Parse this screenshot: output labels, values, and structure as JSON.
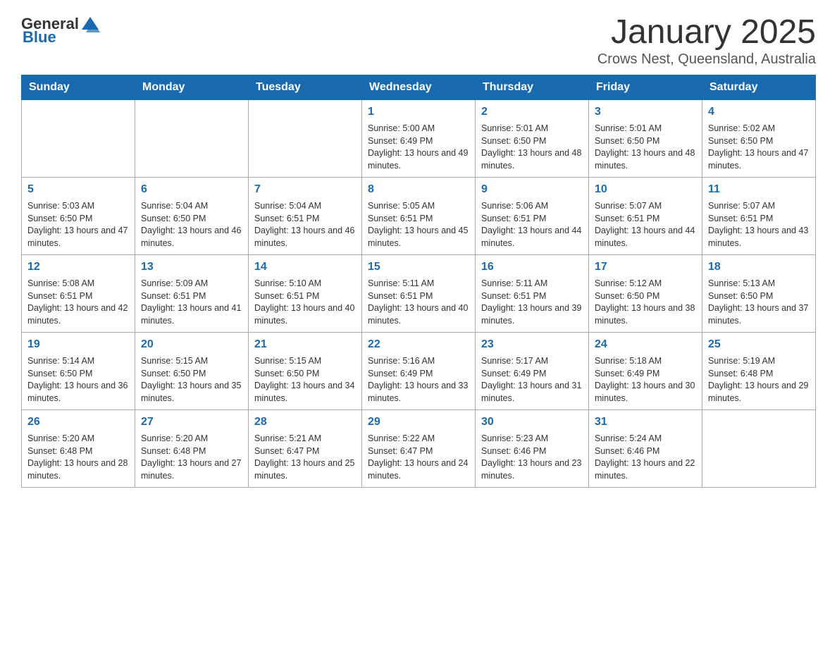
{
  "logo": {
    "text_general": "General",
    "text_blue": "Blue"
  },
  "title": "January 2025",
  "subtitle": "Crows Nest, Queensland, Australia",
  "days_of_week": [
    "Sunday",
    "Monday",
    "Tuesday",
    "Wednesday",
    "Thursday",
    "Friday",
    "Saturday"
  ],
  "weeks": [
    [
      {
        "day": "",
        "info": ""
      },
      {
        "day": "",
        "info": ""
      },
      {
        "day": "",
        "info": ""
      },
      {
        "day": "1",
        "info": "Sunrise: 5:00 AM\nSunset: 6:49 PM\nDaylight: 13 hours and 49 minutes."
      },
      {
        "day": "2",
        "info": "Sunrise: 5:01 AM\nSunset: 6:50 PM\nDaylight: 13 hours and 48 minutes."
      },
      {
        "day": "3",
        "info": "Sunrise: 5:01 AM\nSunset: 6:50 PM\nDaylight: 13 hours and 48 minutes."
      },
      {
        "day": "4",
        "info": "Sunrise: 5:02 AM\nSunset: 6:50 PM\nDaylight: 13 hours and 47 minutes."
      }
    ],
    [
      {
        "day": "5",
        "info": "Sunrise: 5:03 AM\nSunset: 6:50 PM\nDaylight: 13 hours and 47 minutes."
      },
      {
        "day": "6",
        "info": "Sunrise: 5:04 AM\nSunset: 6:50 PM\nDaylight: 13 hours and 46 minutes."
      },
      {
        "day": "7",
        "info": "Sunrise: 5:04 AM\nSunset: 6:51 PM\nDaylight: 13 hours and 46 minutes."
      },
      {
        "day": "8",
        "info": "Sunrise: 5:05 AM\nSunset: 6:51 PM\nDaylight: 13 hours and 45 minutes."
      },
      {
        "day": "9",
        "info": "Sunrise: 5:06 AM\nSunset: 6:51 PM\nDaylight: 13 hours and 44 minutes."
      },
      {
        "day": "10",
        "info": "Sunrise: 5:07 AM\nSunset: 6:51 PM\nDaylight: 13 hours and 44 minutes."
      },
      {
        "day": "11",
        "info": "Sunrise: 5:07 AM\nSunset: 6:51 PM\nDaylight: 13 hours and 43 minutes."
      }
    ],
    [
      {
        "day": "12",
        "info": "Sunrise: 5:08 AM\nSunset: 6:51 PM\nDaylight: 13 hours and 42 minutes."
      },
      {
        "day": "13",
        "info": "Sunrise: 5:09 AM\nSunset: 6:51 PM\nDaylight: 13 hours and 41 minutes."
      },
      {
        "day": "14",
        "info": "Sunrise: 5:10 AM\nSunset: 6:51 PM\nDaylight: 13 hours and 40 minutes."
      },
      {
        "day": "15",
        "info": "Sunrise: 5:11 AM\nSunset: 6:51 PM\nDaylight: 13 hours and 40 minutes."
      },
      {
        "day": "16",
        "info": "Sunrise: 5:11 AM\nSunset: 6:51 PM\nDaylight: 13 hours and 39 minutes."
      },
      {
        "day": "17",
        "info": "Sunrise: 5:12 AM\nSunset: 6:50 PM\nDaylight: 13 hours and 38 minutes."
      },
      {
        "day": "18",
        "info": "Sunrise: 5:13 AM\nSunset: 6:50 PM\nDaylight: 13 hours and 37 minutes."
      }
    ],
    [
      {
        "day": "19",
        "info": "Sunrise: 5:14 AM\nSunset: 6:50 PM\nDaylight: 13 hours and 36 minutes."
      },
      {
        "day": "20",
        "info": "Sunrise: 5:15 AM\nSunset: 6:50 PM\nDaylight: 13 hours and 35 minutes."
      },
      {
        "day": "21",
        "info": "Sunrise: 5:15 AM\nSunset: 6:50 PM\nDaylight: 13 hours and 34 minutes."
      },
      {
        "day": "22",
        "info": "Sunrise: 5:16 AM\nSunset: 6:49 PM\nDaylight: 13 hours and 33 minutes."
      },
      {
        "day": "23",
        "info": "Sunrise: 5:17 AM\nSunset: 6:49 PM\nDaylight: 13 hours and 31 minutes."
      },
      {
        "day": "24",
        "info": "Sunrise: 5:18 AM\nSunset: 6:49 PM\nDaylight: 13 hours and 30 minutes."
      },
      {
        "day": "25",
        "info": "Sunrise: 5:19 AM\nSunset: 6:48 PM\nDaylight: 13 hours and 29 minutes."
      }
    ],
    [
      {
        "day": "26",
        "info": "Sunrise: 5:20 AM\nSunset: 6:48 PM\nDaylight: 13 hours and 28 minutes."
      },
      {
        "day": "27",
        "info": "Sunrise: 5:20 AM\nSunset: 6:48 PM\nDaylight: 13 hours and 27 minutes."
      },
      {
        "day": "28",
        "info": "Sunrise: 5:21 AM\nSunset: 6:47 PM\nDaylight: 13 hours and 25 minutes."
      },
      {
        "day": "29",
        "info": "Sunrise: 5:22 AM\nSunset: 6:47 PM\nDaylight: 13 hours and 24 minutes."
      },
      {
        "day": "30",
        "info": "Sunrise: 5:23 AM\nSunset: 6:46 PM\nDaylight: 13 hours and 23 minutes."
      },
      {
        "day": "31",
        "info": "Sunrise: 5:24 AM\nSunset: 6:46 PM\nDaylight: 13 hours and 22 minutes."
      },
      {
        "day": "",
        "info": ""
      }
    ]
  ]
}
